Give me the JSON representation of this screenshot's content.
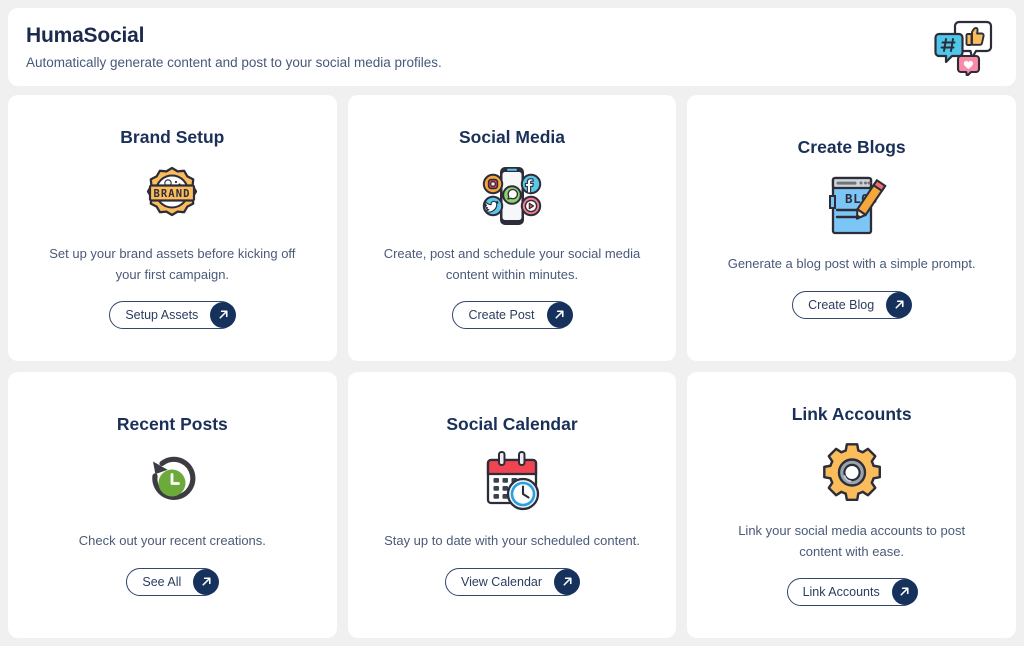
{
  "header": {
    "title": "HumaSocial",
    "subtitle": "Automatically generate content and post to your social media profiles.",
    "icon": "social-bubbles-icon"
  },
  "colors": {
    "page_background": "#f0f0f0",
    "card_background": "#ffffff",
    "title_navy": "#1b2a4e",
    "body_slate": "#4a5a78",
    "button_navy": "#16325c",
    "accent_orange": "#f7b155",
    "accent_green": "#6cab3b",
    "accent_red": "#ef4452",
    "accent_blue": "#4cb3ef"
  },
  "cards": [
    {
      "title": "Brand Setup",
      "icon": "brand-badge-icon",
      "description": "Set up your brand assets before kicking off your first campaign.",
      "button_label": "Setup Assets",
      "button_icon": "arrow-up-right-icon"
    },
    {
      "title": "Social Media",
      "icon": "phone-social-icons-icon",
      "description": "Create, post and schedule your social media content within minutes.",
      "button_label": "Create Post",
      "button_icon": "arrow-up-right-icon"
    },
    {
      "title": "Create Blogs",
      "icon": "blog-document-pencil-icon",
      "description": "Generate a blog post with a simple prompt.",
      "button_label": "Create Blog",
      "button_icon": "arrow-up-right-icon"
    },
    {
      "title": "Recent Posts",
      "icon": "history-clock-icon",
      "description": "Check out your recent creations.",
      "button_label": "See All",
      "button_icon": "arrow-up-right-icon"
    },
    {
      "title": "Social Calendar",
      "icon": "calendar-clock-icon",
      "description": "Stay up to date with your scheduled content.",
      "button_label": "View Calendar",
      "button_icon": "arrow-up-right-icon"
    },
    {
      "title": "Link Accounts",
      "icon": "gear-icon",
      "description": "Link your social media accounts to post content with ease.",
      "button_label": "Link Accounts",
      "button_icon": "arrow-up-right-icon"
    }
  ]
}
